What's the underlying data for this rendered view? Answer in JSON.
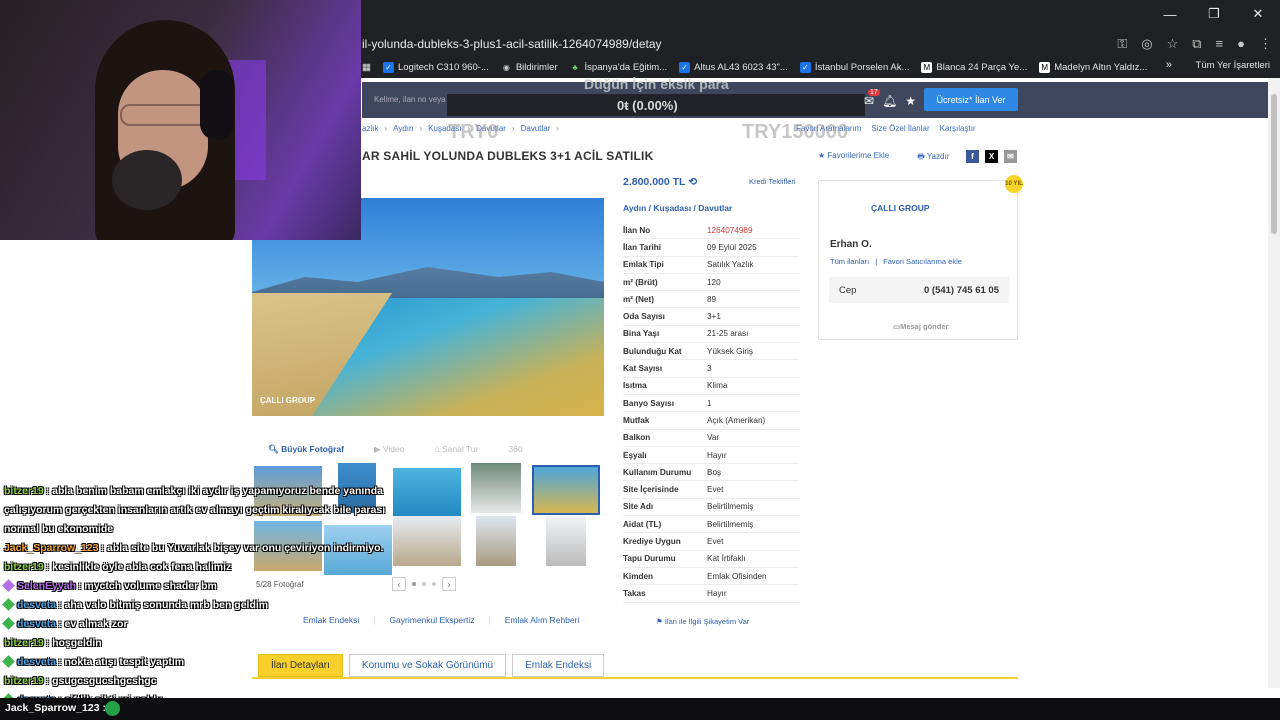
{
  "browser": {
    "url": "il-yolunda-dubleks-3-plus1-acil-satilik-1264074989/detay",
    "bookmarks": [
      "Logitech C310 960-...",
      "Bildirimler",
      "İspanya'da Eğitim...",
      "Altus AL43 6023 43\"...",
      "İstanbul Porselen Ak...",
      "Blanca 24 Parça Ye...",
      "Madelyn Altın Yaldız..."
    ],
    "all_bookmarks": "Tüm Yer İşaretleri",
    "more": "»"
  },
  "header": {
    "search_placeholder": "Kelime, ilan no veya",
    "cta": "Ücretsiz* İlan Ver",
    "notif_count": "17"
  },
  "overlay": {
    "goal_title": "Düğün İçin eksik para",
    "goal_value": "0ŧ (0.00%)",
    "ghost_left": "TRY0",
    "ghost_right": "TRY150000"
  },
  "breadcrumb": [
    "azlık",
    "Aydın",
    "Kuşadası",
    "Davutlar",
    "Davutlar"
  ],
  "crumb_links": [
    "Favori Aramalarım",
    "Size Özel İlanlar",
    "Karşılaştır"
  ],
  "listing": {
    "title": "AR SAHİL YOLUNDA DUBLEKS 3+1 ACİL SATILIK",
    "favorite": "Favorilerime Ekle",
    "print": "Yazdır",
    "price": "2.800.000 TL",
    "credit": "Kredi Teklifleri",
    "location": [
      "Aydın",
      "Kuşadası",
      "Davutlar"
    ],
    "photo_watermark": "ÇALLI GROUP",
    "photo_tabs": [
      "Büyük Fotoğraf",
      "Video",
      "Sanal Tur",
      "360"
    ],
    "photo_count": "5/28 Fotoğraf",
    "complain": "İlan ile İlgili Şikayetim Var"
  },
  "details": [
    {
      "k": "İlan No",
      "v": "1264074989"
    },
    {
      "k": "İlan Tarihi",
      "v": "09 Eylül 2025"
    },
    {
      "k": "Emlak Tipi",
      "v": "Satılık Yazlık"
    },
    {
      "k": "m² (Brüt)",
      "v": "120"
    },
    {
      "k": "m² (Net)",
      "v": "89"
    },
    {
      "k": "Oda Sayısı",
      "v": "3+1"
    },
    {
      "k": "Bina Yaşı",
      "v": "21-25 arası"
    },
    {
      "k": "Bulunduğu Kat",
      "v": "Yüksek Giriş"
    },
    {
      "k": "Kat Sayısı",
      "v": "3"
    },
    {
      "k": "Isıtma",
      "v": "Klima"
    },
    {
      "k": "Banyo Sayısı",
      "v": "1"
    },
    {
      "k": "Mutfak",
      "v": "Açık (Amerikan)"
    },
    {
      "k": "Balkon",
      "v": "Var"
    },
    {
      "k": "Eşyalı",
      "v": "Hayır"
    },
    {
      "k": "Kullanım Durumu",
      "v": "Boş"
    },
    {
      "k": "Site İçerisinde",
      "v": "Evet"
    },
    {
      "k": "Site Adı",
      "v": "Belirtilmemiş"
    },
    {
      "k": "Aidat (TL)",
      "v": "Belirtilmemiş"
    },
    {
      "k": "Krediye Uygun",
      "v": "Evet"
    },
    {
      "k": "Tapu Durumu",
      "v": "Kat İrtifaklı"
    },
    {
      "k": "Kimden",
      "v": "Emlak Ofisinden"
    },
    {
      "k": "Takas",
      "v": "Hayır"
    }
  ],
  "seller": {
    "badge": "10 YIL",
    "company": "ÇALLI GROUP",
    "name": "Erhan O.",
    "all_listings": "Tüm ilanları",
    "favorite_seller": "Favori Satıcılarıma ekle",
    "phone_label": "Cep",
    "phone": "0 (541) 745 61 05",
    "message": "Mesaj gönder"
  },
  "bottom_links": [
    "Emlak Endeksi",
    "Gayrimenkul Ekspertiz",
    "Emlak Alım Rehberi"
  ],
  "tabs": [
    "İlan Detayları",
    "Konumu ve Sokak Görünümü",
    "Emlak Endeksi"
  ],
  "chat": [
    {
      "user": "",
      "text": "",
      "color": "#c9a24a"
    },
    {
      "user": "bitzer19",
      "text": ": abla benim babam emlakçı iki aydır iş yapamıyoruz bende yanında",
      "color": "#8fd14f"
    },
    {
      "user": "",
      "text": "çalışıyorum gerçekten insanların artık ev almayı geçtim kiralıycak bile parası",
      "color": "#fff"
    },
    {
      "user": "",
      "text": "normal bu ekonomide",
      "color": "#fff"
    },
    {
      "user": "Jack_Sparrow_123",
      "text": ": abla site bu Yuvarlak bişey var onu çeviriyon indirmiyo.",
      "color": "#f2a33a"
    },
    {
      "user": "bitzer19",
      "text": ": kesinlikle öyle abla cok fena halimiz",
      "color": "#8fd14f"
    },
    {
      "user": "SelenEyyah",
      "text": ": myctch volume shader bm",
      "color": "#b36ee8"
    },
    {
      "user": "desveta",
      "text": ": aha valo bitmiş sonunda mrb ben geldim",
      "color": "#4aa3e0"
    },
    {
      "user": "desveta",
      "text": ": ev almak zor",
      "color": "#4aa3e0"
    },
    {
      "user": "bitzer19",
      "text": ": hoşgeldin",
      "color": "#8fd14f"
    },
    {
      "user": "desveta",
      "text": ": nokta atışı tespit yaptım",
      "color": "#4aa3e0"
    },
    {
      "user": "bitzer19",
      "text": ": gsugcsgucshgcshgc",
      "color": "#8fd14f"
    },
    {
      "user": "desveta",
      "text": ": çiftlik sikti mi noldu",
      "color": "#4aa3e0"
    }
  ],
  "chat_input_user": "Jack_Sparrow_123 :",
  "colors": {
    "accent": "#2d5fb0",
    "header": "#3f475f",
    "tab_active": "#f8d02b",
    "cta": "#2f88e4"
  }
}
